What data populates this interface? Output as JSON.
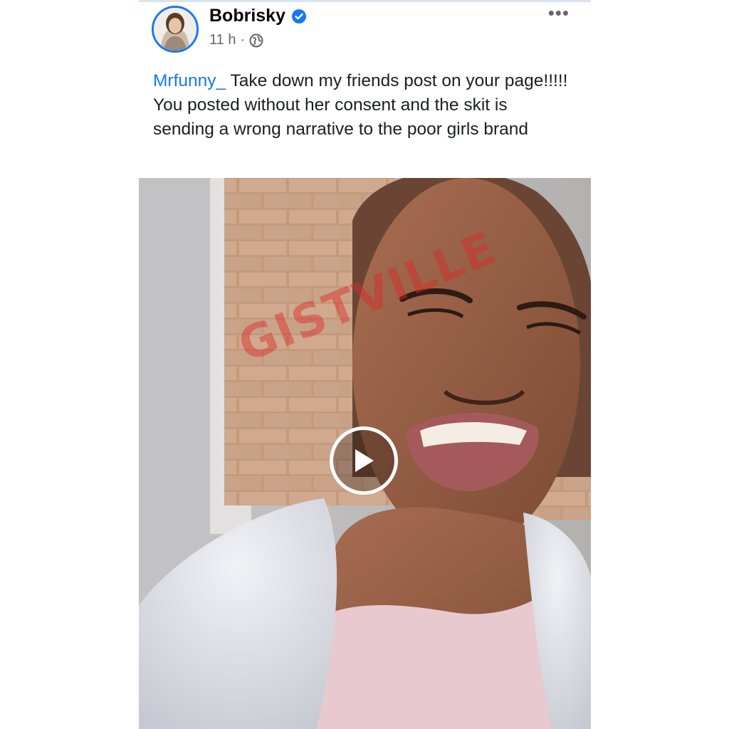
{
  "post": {
    "author": "Bobrisky",
    "time": "11 h",
    "separator": "·",
    "more_label": "•••",
    "caption_mention": "Mrfunny_",
    "caption_text": " Take down my friends post on your page!!!!! You posted without her consent and the skit is sending a wrong narrative to the poor girls brand",
    "watermark": "GISTVILLE"
  },
  "icons": {
    "verified": "verified-badge-icon",
    "audience": "globe-icon",
    "more": "more-options-icon",
    "play": "play-icon"
  },
  "colors": {
    "accent": "#1877f2",
    "text": "#1c1e21",
    "meta": "#65676b",
    "watermark": "#dc2828"
  }
}
